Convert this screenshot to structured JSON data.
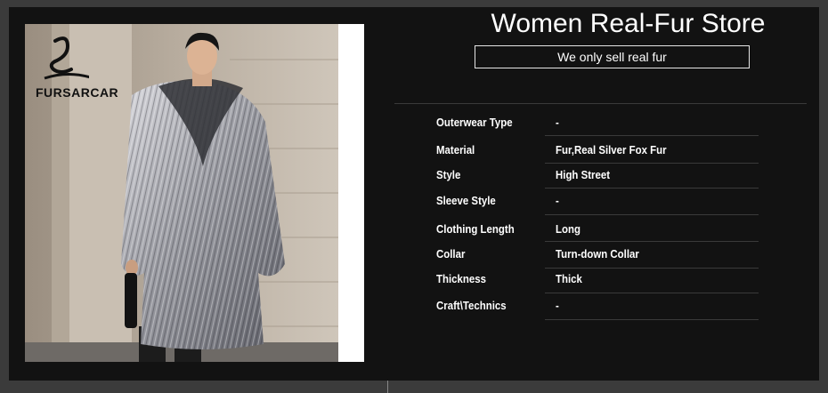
{
  "brand": {
    "logo_text": "FURSARCAR"
  },
  "store": {
    "title": "Women Real-Fur Store",
    "tagline": "We only sell real fur"
  },
  "specs": [
    {
      "label": "Outerwear Type",
      "value": "-"
    },
    {
      "label": "Material",
      "value": "Fur,Real Silver Fox Fur"
    },
    {
      "label": "Style",
      "value": "High Street"
    },
    {
      "label": "Sleeve Style",
      "value": "-"
    },
    {
      "label": "Clothing Length",
      "value": "Long"
    },
    {
      "label": "Collar",
      "value": "Turn-down Collar"
    },
    {
      "label": "Thickness",
      "value": "Thick"
    },
    {
      "label": "Craft\\Technics",
      "value": "-"
    }
  ],
  "colors": {
    "panel": "#121212",
    "page": "#3b3b3b",
    "text": "#ffffff"
  }
}
